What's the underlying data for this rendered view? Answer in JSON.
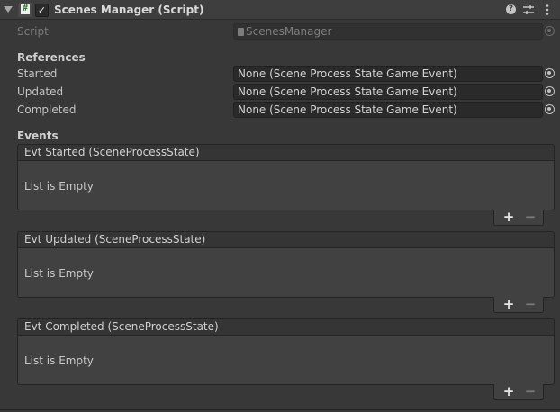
{
  "component": {
    "title": "Scenes Manager (Script)",
    "enabled": true,
    "checkbox_glyph": "✓",
    "script_icon_glyph": "#",
    "help_icon": "help-icon",
    "presets_icon": "presets-icon",
    "menu_icon": "context-menu-icon"
  },
  "script_field": {
    "label": "Script",
    "value": "ScenesManager"
  },
  "references": {
    "header": "References",
    "fields": [
      {
        "label": "Started",
        "value": "None (Scene Process State Game Event)"
      },
      {
        "label": "Updated",
        "value": "None (Scene Process State Game Event)"
      },
      {
        "label": "Completed",
        "value": "None (Scene Process State Game Event)"
      }
    ]
  },
  "events": {
    "header": "Events",
    "lists": [
      {
        "title": "Evt Started (SceneProcessState)",
        "empty_text": "List is Empty"
      },
      {
        "title": "Evt Updated (SceneProcessState)",
        "empty_text": "List is Empty"
      },
      {
        "title": "Evt Completed (SceneProcessState)",
        "empty_text": "List is Empty"
      }
    ],
    "add_glyph": "+",
    "remove_glyph": "−"
  },
  "colors": {
    "background": "#383838",
    "field_bg": "#2a2a2a",
    "header_bg": "#3e3e3e"
  }
}
